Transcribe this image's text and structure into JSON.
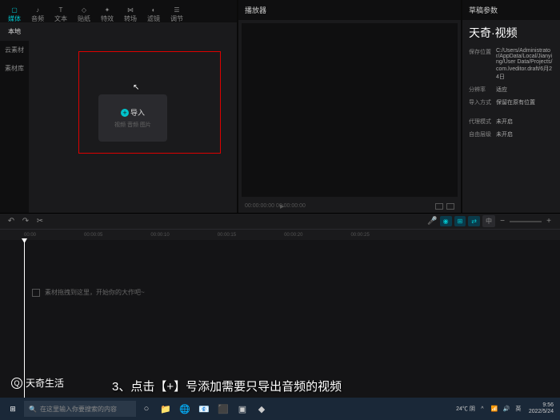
{
  "tabs": [
    {
      "label": "媒体",
      "active": true
    },
    {
      "label": "音频"
    },
    {
      "label": "文本"
    },
    {
      "label": "贴纸"
    },
    {
      "label": "特效"
    },
    {
      "label": "转场"
    },
    {
      "label": "滤镜"
    },
    {
      "label": "调节"
    }
  ],
  "sidebar": [
    {
      "label": "本地",
      "active": true
    },
    {
      "label": "云素材"
    },
    {
      "label": "素材库"
    }
  ],
  "import": {
    "btn": "导入",
    "sub": "视频 音频 图片"
  },
  "preview": {
    "title": "播放器",
    "time": "00:00:00:00  00:00:00:00"
  },
  "props": {
    "title": "草稿参数",
    "brand1": "天奇·",
    "brand2": "视频",
    "rows": [
      {
        "lbl": "保存位置",
        "val": "C:/Users/Administrator/AppData/Local/Jianying/User Data/Projects/com.lveditor.draft/6月24日"
      },
      {
        "lbl": "分辨率",
        "val": "适应"
      },
      {
        "lbl": "导入方式",
        "val": "保留在原有位置"
      },
      {
        "lbl": "代理模式",
        "val": "未开启"
      },
      {
        "lbl": "自由层级",
        "val": "未开启"
      }
    ]
  },
  "ruler": [
    "00:00",
    "00:00:05",
    "00:00:10",
    "00:00:15",
    "00:00:20",
    "00:00:25"
  ],
  "trackHint": "素材拖拽到这里，开始你的大作吧~",
  "watermark": "天奇生活",
  "caption": "3、点击【+】号添加需要只导出音频的视频",
  "taskbar": {
    "search": "在这里输入你要搜索的内容",
    "weather": "24℃ 阴",
    "time": "9:56",
    "date": "2022/5/24"
  }
}
